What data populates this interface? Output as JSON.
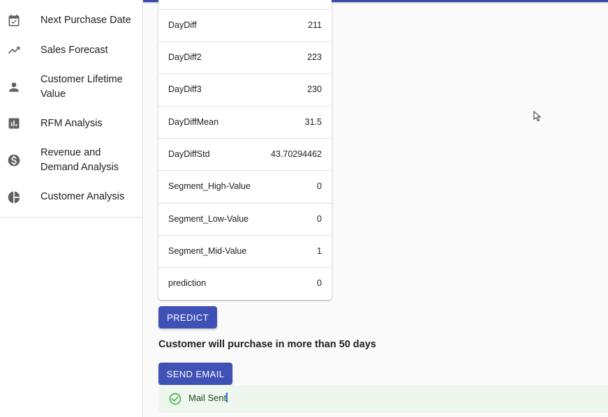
{
  "sidebar": {
    "items": [
      {
        "label": "Next Purchase Date",
        "icon": "calendar-check-icon"
      },
      {
        "label": "Sales Forecast",
        "icon": "trending-up-icon"
      },
      {
        "label": "Customer Lifetime Value",
        "icon": "person-icon"
      },
      {
        "label": "RFM Analysis",
        "icon": "bar-chart-icon"
      },
      {
        "label": "Revenue and Demand Analysis",
        "icon": "dollar-circle-icon"
      },
      {
        "label": "Customer Analysis",
        "icon": "pie-chart-icon"
      }
    ]
  },
  "table": {
    "rows": [
      {
        "name": "DayDiff",
        "value": "211"
      },
      {
        "name": "DayDiff2",
        "value": "223"
      },
      {
        "name": "DayDiff3",
        "value": "230"
      },
      {
        "name": "DayDiffMean",
        "value": "31.5"
      },
      {
        "name": "DayDiffStd",
        "value": "43.70294462"
      },
      {
        "name": "Segment_High-Value",
        "value": "0"
      },
      {
        "name": "Segment_Low-Value",
        "value": "0"
      },
      {
        "name": "Segment_Mid-Value",
        "value": "1"
      },
      {
        "name": "prediction",
        "value": "0"
      }
    ]
  },
  "actions": {
    "predict_label": "PREDICT",
    "send_email_label": "SEND EMAIL"
  },
  "result": {
    "text": "Customer will purchase in more than 50 days"
  },
  "alert": {
    "text": "Mail Sent",
    "icon": "check-circle-icon",
    "status": "success"
  },
  "colors": {
    "primary": "#3f51b5",
    "success_bg": "#edf7ed",
    "success_icon": "#4caf50"
  }
}
